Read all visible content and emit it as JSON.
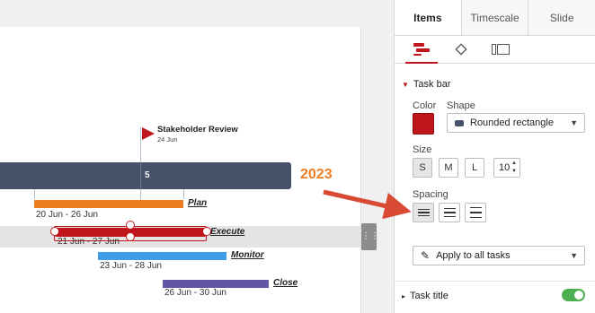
{
  "milestone": {
    "title": "Stakeholder Review",
    "date": "24 Jun"
  },
  "timescale": {
    "segment_label": "5",
    "year": "2023"
  },
  "tasks": [
    {
      "name": "Plan",
      "dates": "20 Jun - 26 Jun",
      "color": "#ee7d22"
    },
    {
      "name": "Execute",
      "dates": "21 Jun - 27 Jun",
      "color": "#c0161b"
    },
    {
      "name": "Monitor",
      "dates": "23 Jun - 28 Jun",
      "color": "#3e9fe8"
    },
    {
      "name": "Close",
      "dates": "26 Jun - 30 Jun",
      "color": "#6355a3"
    }
  ],
  "panel": {
    "tabs": [
      "Items",
      "Timescale",
      "Slide"
    ],
    "active_tab": "Items",
    "icon_tabs": [
      "taskbar-icon",
      "milestone-diamond-icon",
      "swimlane-icon"
    ],
    "section": "Task bar",
    "color_label": "Color",
    "color_value": "#c0161b",
    "shape_label": "Shape",
    "shape_value": "Rounded rectangle",
    "size_label": "Size",
    "sizes": [
      "S",
      "M",
      "L"
    ],
    "active_size": "S",
    "size_number": "10",
    "spacing_label": "Spacing",
    "apply_label": "Apply to all tasks",
    "task_title_label": "Task title",
    "task_title_enabled": true
  },
  "colors": {
    "accent": "#c0161b",
    "timescale": "#45526a",
    "year": "#ee7d22",
    "toggle": "#4caf50"
  }
}
